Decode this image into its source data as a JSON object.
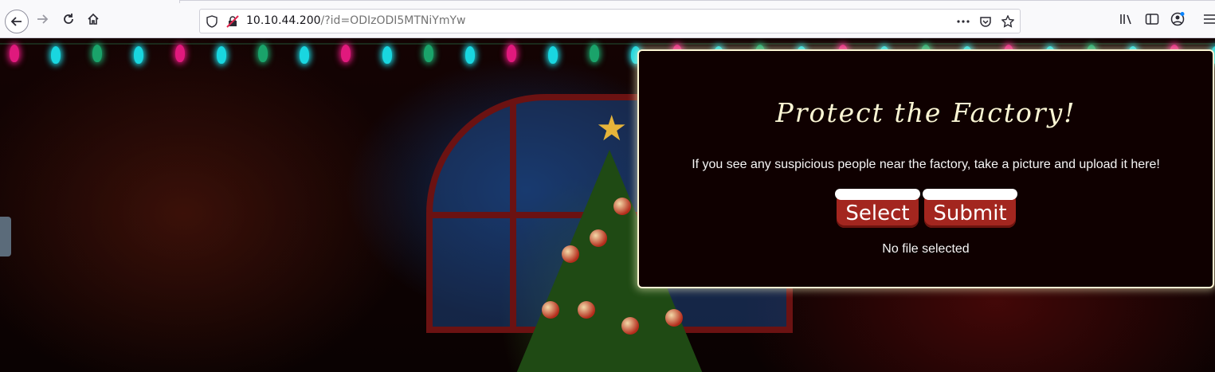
{
  "browser": {
    "url_host": "10.10.44.200",
    "url_path": "/?id=ODIzODI5MTNiYmYw",
    "icons": {
      "back": "back-arrow-icon",
      "forward": "forward-arrow-icon",
      "reload": "reload-icon",
      "home": "home-icon",
      "shield": "shield-icon",
      "insecure": "insecure-lock-icon",
      "more": "more-actions-icon",
      "pocket": "pocket-icon",
      "bookmark": "bookmark-star-icon",
      "library": "library-icon",
      "sidebar": "sidebar-icon",
      "account": "account-icon",
      "menu": "hamburger-menu-icon"
    }
  },
  "upload": {
    "title": "Protect the Factory!",
    "description": "If you see any suspicious people near the factory, take a picture and upload it here!",
    "select_label": "Select",
    "submit_label": "Submit",
    "file_status": "No file selected"
  },
  "colors": {
    "panel_bg": "#0f0000",
    "panel_border": "#fbf6d4",
    "button_red": "#a3261f",
    "title_cream": "#fbf6d4"
  }
}
